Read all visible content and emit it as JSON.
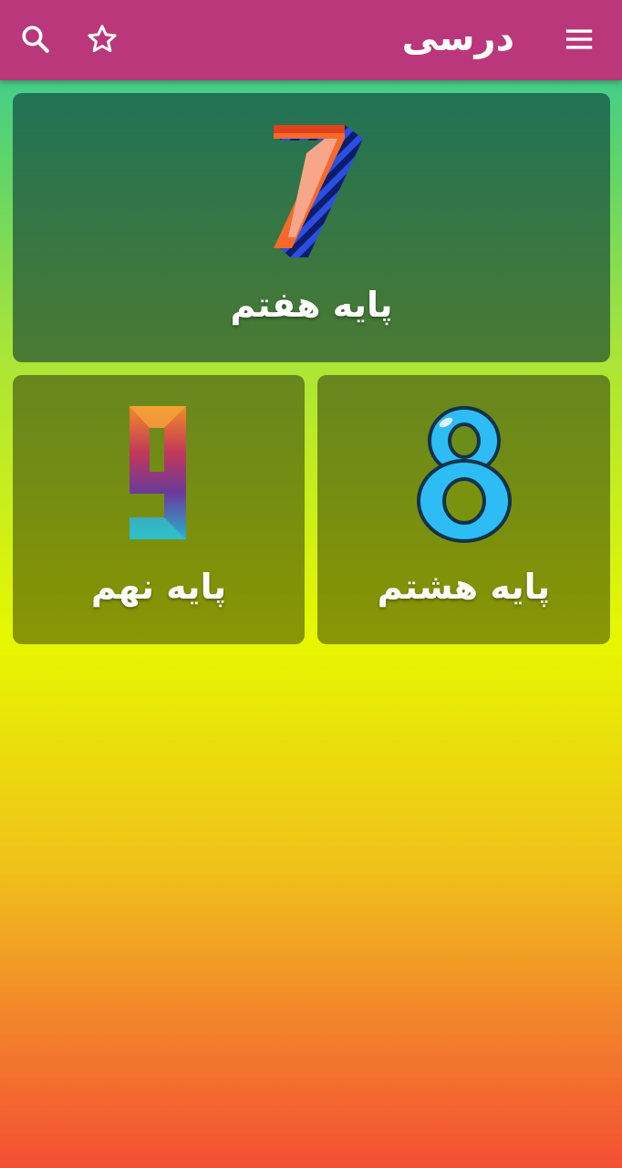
{
  "app_bar": {
    "title": "درسی",
    "icons": [
      "menu-icon",
      "favorites-star-icon",
      "search-icon"
    ]
  },
  "grades": [
    {
      "label": "پایه هفتم",
      "digit": "7"
    },
    {
      "label": "پایه هشتم",
      "digit": "8"
    },
    {
      "label": "پایه نهم",
      "digit": "9"
    }
  ],
  "colors": {
    "app_bar_bg": "#b9377a",
    "card_top_bg": "#257559",
    "card_bottom_bg": "#7c8f17",
    "digit_8_fill": "#2dbdf4"
  }
}
